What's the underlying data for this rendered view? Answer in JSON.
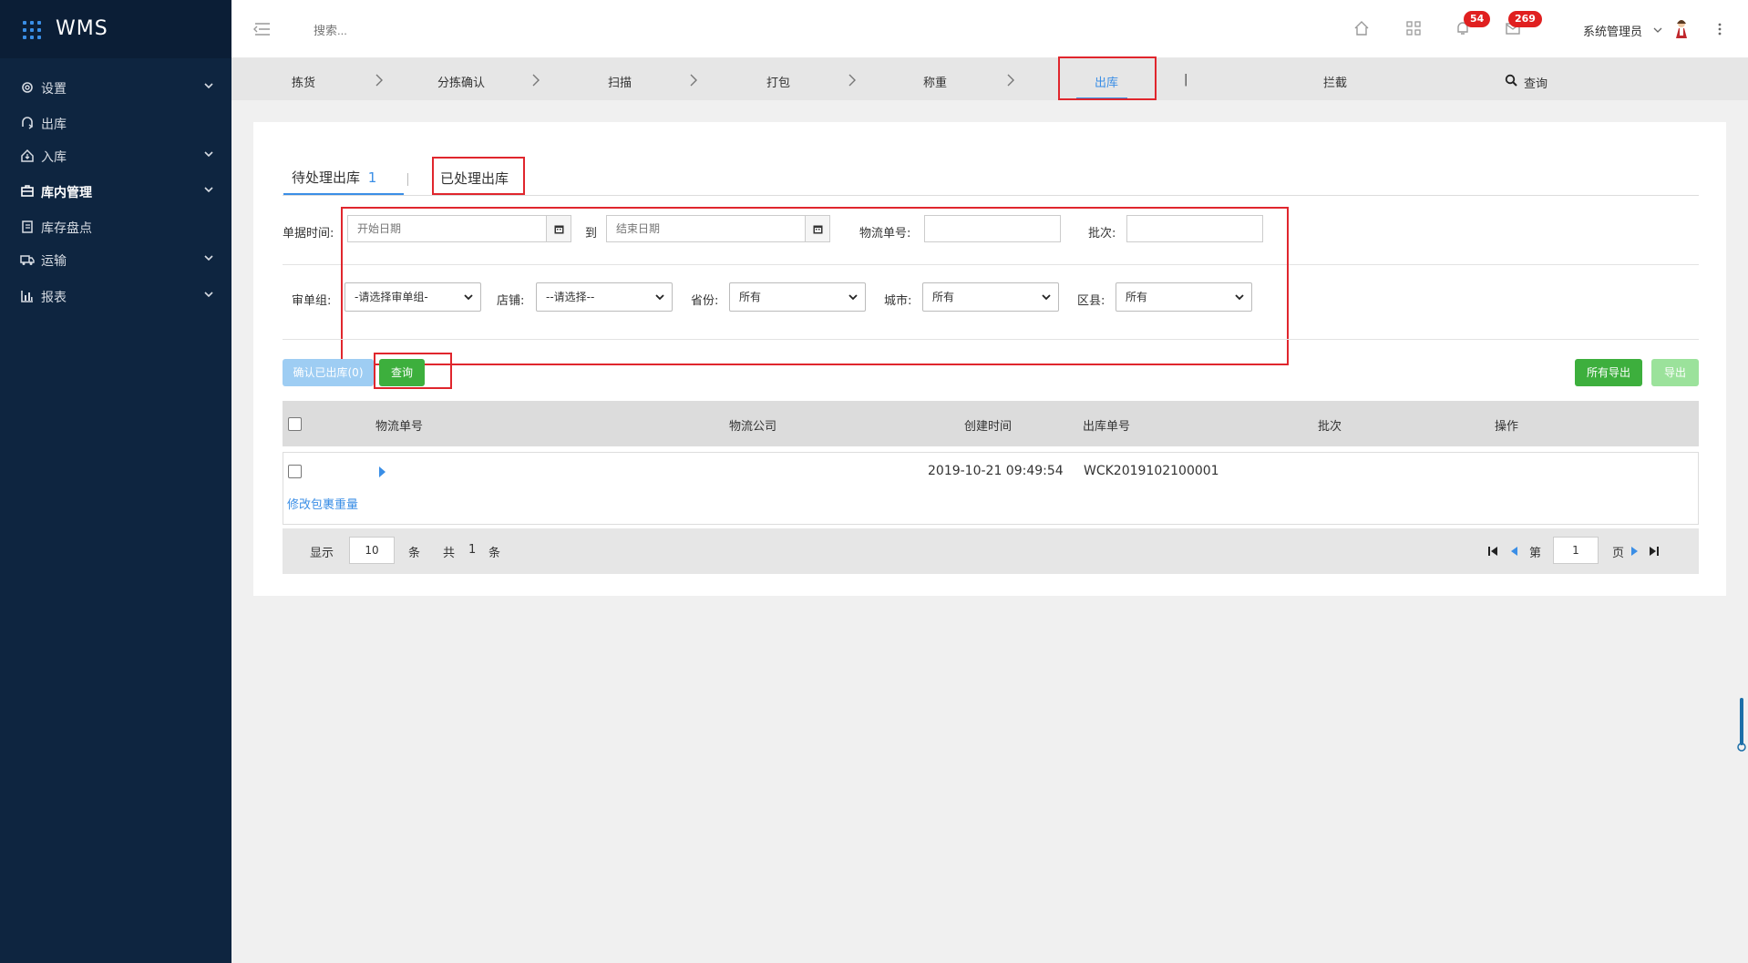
{
  "app": {
    "title": "WMS"
  },
  "sidebar": {
    "items": [
      {
        "label": "设置",
        "icon": "gear-icon"
      },
      {
        "label": "出库",
        "icon": "outbound-icon"
      },
      {
        "label": "入库",
        "icon": "inbound-icon"
      },
      {
        "label": "库内管理",
        "icon": "warehouse-icon"
      },
      {
        "label": "库存盘点",
        "icon": "inventory-icon"
      },
      {
        "label": "运输",
        "icon": "truck-icon"
      },
      {
        "label": "报表",
        "icon": "bar-chart-icon"
      }
    ]
  },
  "topbar": {
    "search_placeholder": "搜索...",
    "notifications_count": "54",
    "messages_count": "269",
    "user_name": "系统管理员"
  },
  "steps": {
    "items": [
      "拣货",
      "分拣确认",
      "扫描",
      "打包",
      "称重",
      "出库"
    ],
    "divider": "|",
    "intercept": "拦截",
    "query": "查询"
  },
  "tabs": {
    "pending_label": "待处理出库",
    "pending_count": "1",
    "processed_label": "已处理出库"
  },
  "filters": {
    "doc_time_label": "单据时间:",
    "start_placeholder": "开始日期",
    "to_label": "到",
    "end_placeholder": "结束日期",
    "tracking_no_label": "物流单号:",
    "batch_label": "批次:",
    "review_group_label": "审单组:",
    "review_group_value": "-请选择审单组-",
    "store_label": "店铺:",
    "store_value": "--请选择--",
    "province_label": "省份:",
    "province_value": "所有",
    "city_label": "城市:",
    "city_value": "所有",
    "county_label": "区县:",
    "county_value": "所有"
  },
  "actions": {
    "confirm_label": "确认已出库(0)",
    "query_label": "查询",
    "export_all_label": "所有导出",
    "export_label": "导出"
  },
  "table": {
    "headers": [
      "物流单号",
      "物流公司",
      "创建时间",
      "出库单号",
      "批次",
      "操作"
    ],
    "rows": [
      {
        "tracking_no": "",
        "company": "",
        "created": "2019-10-21 09:49:54",
        "outbound_no": "WCK2019102100001",
        "batch": "",
        "link": "修改包裹重量"
      }
    ]
  },
  "pagination": {
    "show_label": "显示",
    "page_size": "10",
    "unit": "条",
    "total_label": "共",
    "total": "1",
    "total_unit": "条",
    "page_label": "第",
    "current_page": "1",
    "page_unit": "页"
  },
  "colors": {
    "sidebar_bg": "#0e2540",
    "accent_blue": "#3a8ee6",
    "green": "#3daf3d",
    "highlight_red": "#e0262d"
  }
}
